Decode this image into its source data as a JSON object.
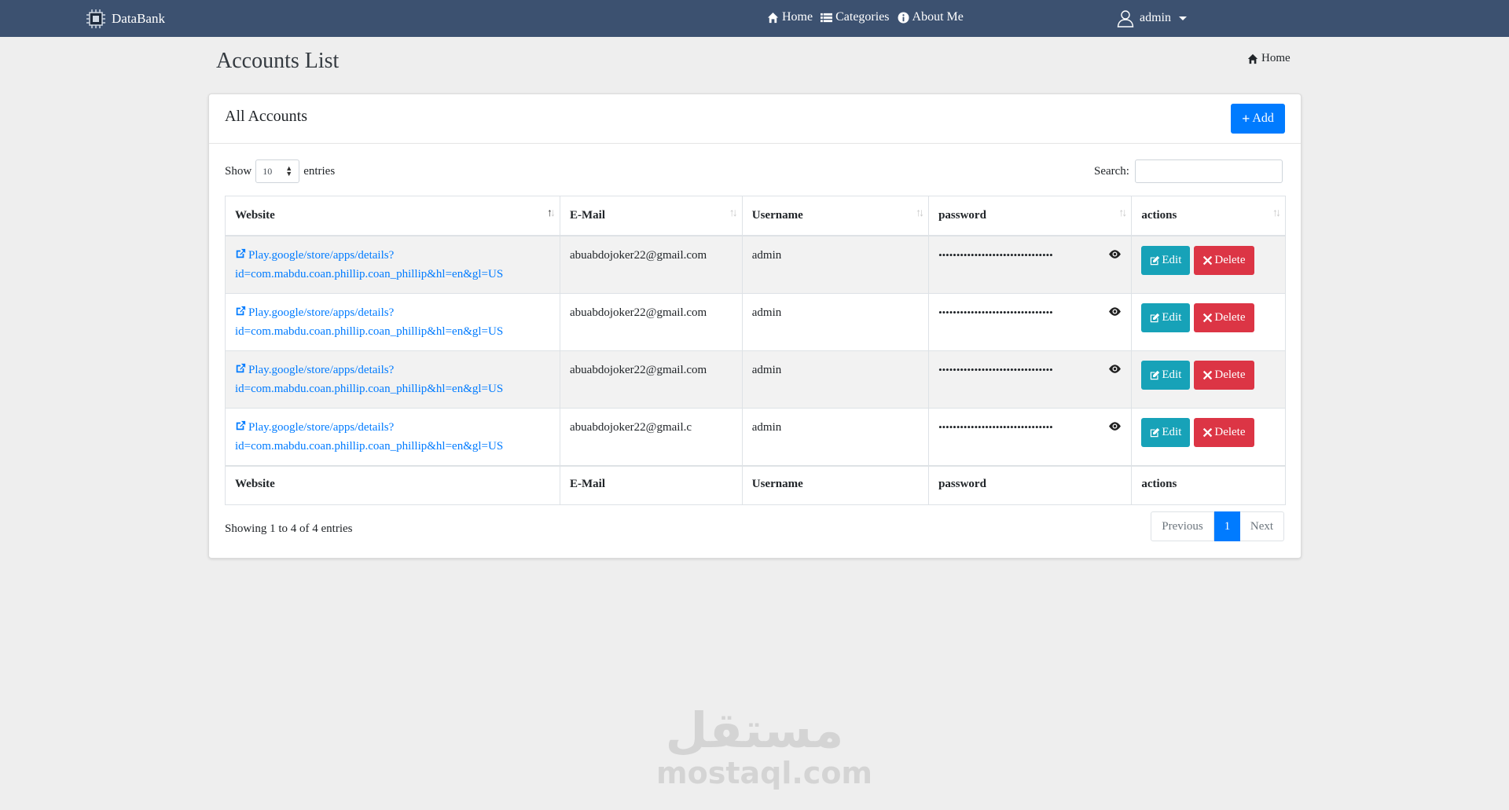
{
  "navbar": {
    "brand": "DataBank",
    "links": [
      {
        "label": "Home",
        "icon": "home-icon"
      },
      {
        "label": "Categories",
        "icon": "list-icon"
      },
      {
        "label": "About Me",
        "icon": "info-icon"
      }
    ],
    "user": "admin"
  },
  "header": {
    "title": "Accounts List",
    "breadcrumb": "Home"
  },
  "card": {
    "title": "All Accounts",
    "add_label": "Add",
    "show_label": "Show",
    "entries_value": "10",
    "entries_label": "entries",
    "search_label": "Search:",
    "search_value": ""
  },
  "table": {
    "columns": [
      "Website",
      "E-Mail",
      "Username",
      "password",
      "actions"
    ],
    "rows": [
      {
        "website": "Play.google/store/apps/details?",
        "website2": "id=com.mabdu.coan.phillip.coan_phillip&hl=en&gl=US",
        "email": "abuabdojoker22@gmail.com",
        "username": "admin",
        "password": "••••••••••••••••••••••••••••••••"
      },
      {
        "website": "Play.google/store/apps/details?",
        "website2": "id=com.mabdu.coan.phillip.coan_phillip&hl=en&gl=US",
        "email": "abuabdojoker22@gmail.com",
        "username": "admin",
        "password": "••••••••••••••••••••••••••••••••"
      },
      {
        "website": "Play.google/store/apps/details?",
        "website2": "id=com.mabdu.coan.phillip.coan_phillip&hl=en&gl=US",
        "email": "abuabdojoker22@gmail.com",
        "username": "admin",
        "password": "••••••••••••••••••••••••••••••••"
      },
      {
        "website": "Play.google/store/apps/details?",
        "website2": "id=com.mabdu.coan.phillip.coan_phillip&hl=en&gl=US",
        "email": "abuabdojoker22@gmail.c",
        "username": "admin",
        "password": "••••••••••••••••••••••••••••••••"
      }
    ],
    "edit_label": "Edit",
    "delete_label": "Delete"
  },
  "footer": {
    "info": "Showing 1 to 4 of 4 entries",
    "previous": "Previous",
    "page": "1",
    "next": "Next"
  },
  "watermark": {
    "arabic": "مستقل",
    "latin": "mostaql.com"
  },
  "colors": {
    "navbar": "#3c5170",
    "primary": "#007bff",
    "info": "#17a2b8",
    "danger": "#dc3545"
  }
}
